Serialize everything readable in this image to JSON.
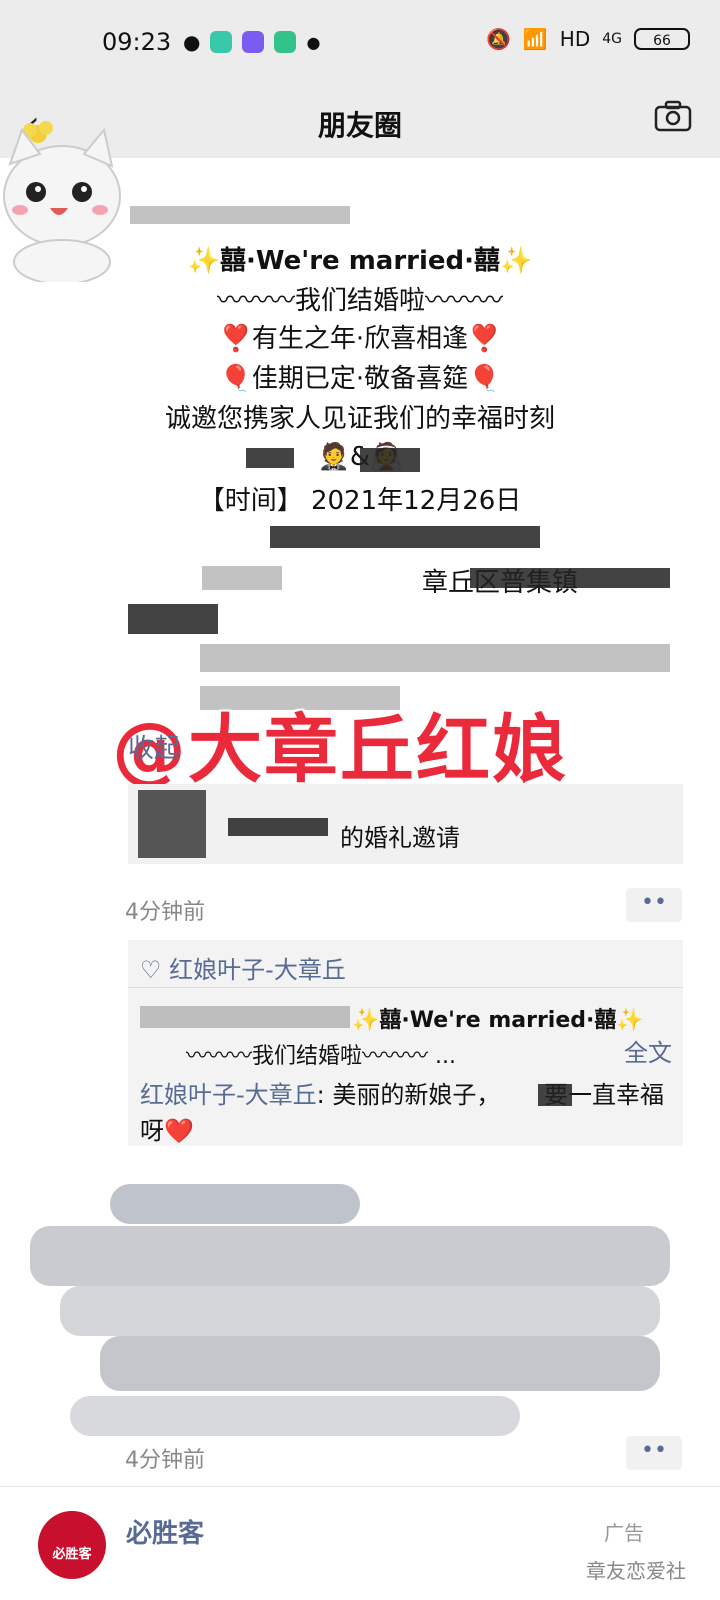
{
  "status_bar": {
    "time": "09:23",
    "network": "HD",
    "signal": "4G",
    "battery": "66"
  },
  "header": {
    "title": "朋友圈"
  },
  "post": {
    "lines": [
      "✨囍·We're married·囍✨",
      "〰〰〰我们结婚啦〰〰〰",
      "❣️有生之年·欣喜相逢❣️",
      "🎈佳期已定·敬备喜筵🎈",
      "诚邀您携家人见证我们的幸福时刻",
      "🤵&👰",
      "【时间】 2021年12月26日",
      "章丘区普集镇"
    ],
    "collapse": "收起",
    "share_text": "的婚礼邀请",
    "time": "4分钟前",
    "more": "••"
  },
  "watermark": "@大章丘红娘",
  "comments": {
    "like_name": "红娘叶子-大章丘",
    "quote_line1": "✨囍·We're married·囍✨",
    "quote_line2": "〰〰〰我们结婚啦〰〰〰 ...",
    "fulltext": "全文",
    "commenter": "红娘叶子-大章丘",
    "comment_text": ": 美丽的新娘子，　　 要一直幸福呀❤️"
  },
  "post2": {
    "time": "4分钟前",
    "more": "••"
  },
  "ad": {
    "logo_text": "必胜客",
    "name": "必胜客",
    "tag": "广告",
    "source_watermark": "章友恋爱社"
  },
  "colors": {
    "link": "#576b95",
    "watermark": "#ea2a3b",
    "brand_ad": "#c8102e"
  }
}
